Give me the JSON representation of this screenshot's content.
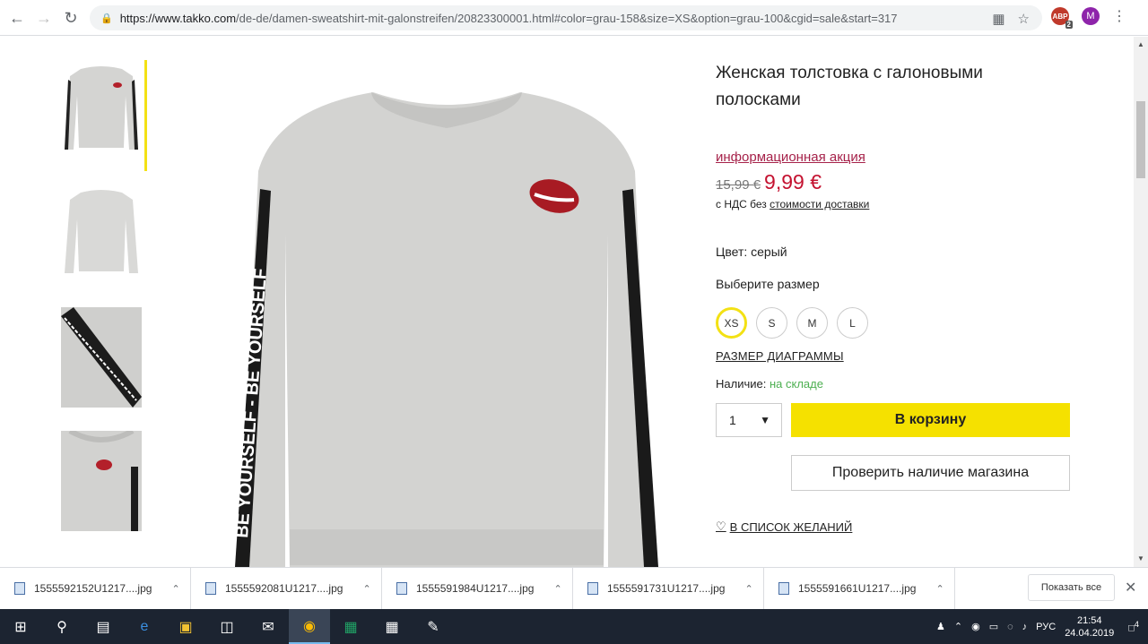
{
  "browser": {
    "url_host": "https://www.takko.com",
    "url_rest": "/de-de/damen-sweatshirt-mit-galonstreifen/20823300001.html#color=grau-158&size=XS&option=grau-100&cgid=sale&start=317",
    "abp_label": "ABP",
    "abp_count": "2",
    "avatar_letter": "M"
  },
  "product": {
    "title": "Женская толстовка с галоновыми полосками",
    "promo_link": "информационная акция",
    "old_price": "15,99 €",
    "new_price": "9,99 €",
    "vat_prefix": "с НДС без ",
    "vat_link": "стоимости доставки",
    "color_label": "Цвет: серый",
    "size_label": "Выберите размер",
    "sizes": [
      "XS",
      "S",
      "M",
      "L"
    ],
    "selected_size": "XS",
    "size_chart_link": "РАЗМЕР ДИАГРАММЫ",
    "availability_label": "Наличие: ",
    "availability_value": "на складе",
    "quantity": "1",
    "add_to_cart": "В корзину",
    "check_store": "Проверить наличие магазина",
    "wishlist": "В СПИСОК ЖЕЛАНИЙ",
    "sleeve_text": "BE YOURSELF - BE YOURSELF"
  },
  "downloads": {
    "items": [
      "1555592152U1217....jpg",
      "1555592081U1217....jpg",
      "1555591984U1217....jpg",
      "1555591731U1217....jpg",
      "1555591661U1217....jpg"
    ],
    "show_all": "Показать все"
  },
  "taskbar": {
    "language": "РУС",
    "time": "21:54",
    "date": "24.04.2019",
    "notification_count": "4"
  }
}
